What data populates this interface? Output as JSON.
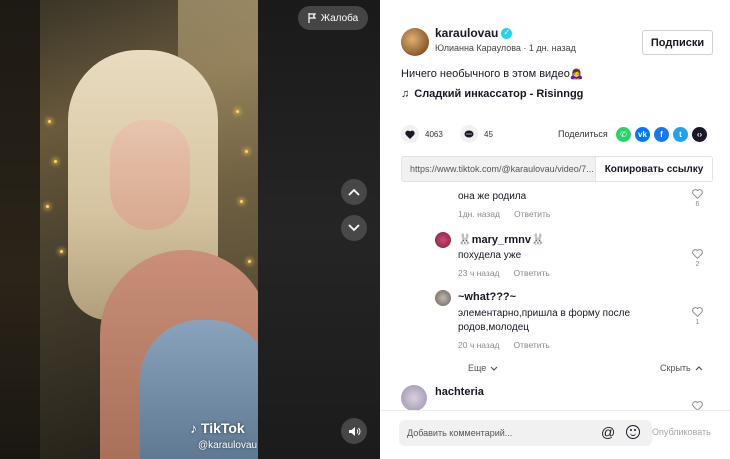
{
  "video": {
    "report_label": "Жалоба",
    "watermark": "TikTok",
    "watermark_user": "@karaulovau"
  },
  "author": {
    "username": "karaulovau",
    "subline": "Юлианна Караулова · 1 дн. назад",
    "follow_label": "Подписки"
  },
  "post": {
    "description": "Ничего необычного в этом видео🙇‍♀️",
    "music": "Сладкий инкассатор - Risinngg"
  },
  "actions": {
    "likes": "4063",
    "comments": "45",
    "share_label": "Поделиться"
  },
  "link": {
    "url": "https://www.tiktok.com/@karaulovau/video/7...",
    "copy_label": "Копировать ссылку"
  },
  "comments": [
    {
      "text": "она же родила",
      "time": "1дн. назад",
      "reply": "Ответить",
      "likes": "6"
    },
    {
      "user": "🐰mary_rmnv🐰",
      "text": "похудела уже",
      "time": "23 ч назад",
      "reply": "Ответить",
      "likes": "2"
    },
    {
      "user": "~what???~",
      "text1": "элементарно,пришла в форму после",
      "text2": "родов,молодец",
      "time": "20 ч назад",
      "reply": "Ответить",
      "likes": "1"
    }
  ],
  "thread": {
    "more_label": "Еще",
    "hide_label": "Скрыть"
  },
  "next_comment_user": "hachteria",
  "composer": {
    "placeholder": "Добавить комментарий...",
    "post_label": "Опубликовать"
  },
  "colors": {
    "verified": "#20d5ec",
    "whatsapp": "#25d366",
    "vk": "#0077ff",
    "facebook": "#1877f2",
    "twitter": "#1da1f2",
    "embed": "#161823"
  }
}
